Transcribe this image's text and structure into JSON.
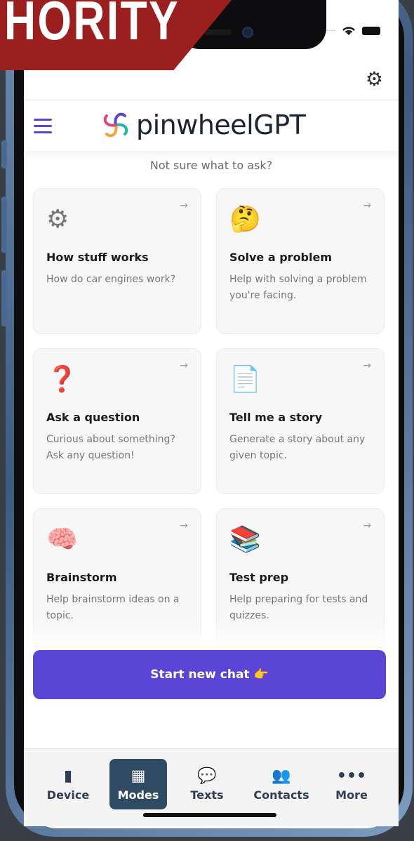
{
  "banner": {
    "text": "HORITY"
  },
  "app": {
    "name": "pinwheelGPT"
  },
  "prompt": "Not sure what to ask?",
  "cards": [
    {
      "emoji": "⚙",
      "title": "How stuff works",
      "desc": "How do car engines work?",
      "arrow": "→"
    },
    {
      "emoji": "🤔",
      "title": "Solve a problem",
      "desc": "Help with solving a problem you're facing.",
      "arrow": "→"
    },
    {
      "emoji": "❓",
      "title": "Ask a question",
      "desc": "Curious about something? Ask any question!",
      "arrow": "→"
    },
    {
      "emoji": "📄",
      "title": "Tell me a story",
      "desc": "Generate a story about any given topic.",
      "arrow": "→"
    },
    {
      "emoji": "🧠",
      "title": "Brainstorm",
      "desc": "Help brainstorm ideas on a topic.",
      "arrow": "→"
    },
    {
      "emoji": "📚",
      "title": "Test prep",
      "desc": "Help preparing for tests and quizzes.",
      "arrow": "→"
    }
  ],
  "cta": {
    "label": "Start new chat",
    "emoji": "👉"
  },
  "tabs": [
    {
      "label": "Device",
      "icon": "device-icon",
      "glyph": "▮"
    },
    {
      "label": "Modes",
      "icon": "calendar-icon",
      "glyph": "▦"
    },
    {
      "label": "Texts",
      "icon": "chat-bubble-icon",
      "glyph": "💬"
    },
    {
      "label": "Contacts",
      "icon": "contacts-icon",
      "glyph": "👥"
    },
    {
      "label": "More",
      "icon": "more-icon",
      "glyph": "•••"
    }
  ],
  "colors": {
    "accent": "#5b45d6",
    "activeTab": "#2f4a63",
    "banner": "#9c1f1f"
  }
}
